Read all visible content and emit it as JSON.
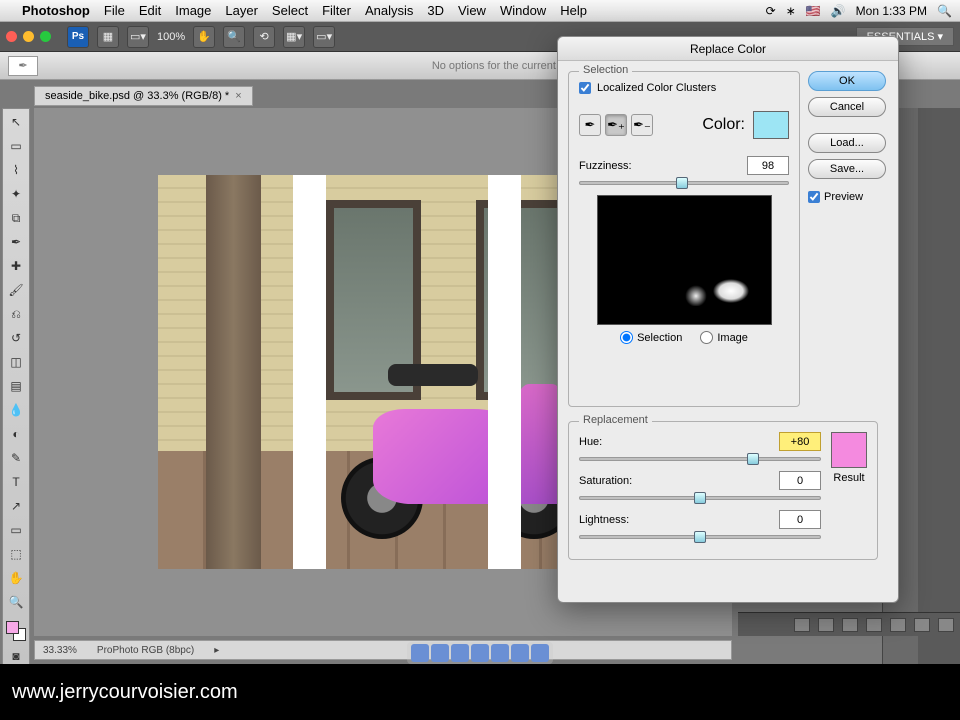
{
  "menubar": {
    "app": "Photoshop",
    "items": [
      "File",
      "Edit",
      "Image",
      "Layer",
      "Select",
      "Filter",
      "Analysis",
      "3D",
      "View",
      "Window",
      "Help"
    ],
    "clock": "Mon 1:33 PM"
  },
  "toolbar": {
    "zoom": "100%",
    "essentials": "ESSENTIALS ▾"
  },
  "optionsbar": {
    "msg": "No options for the current to"
  },
  "document": {
    "tab": "seaside_bike.psd @ 33.3% (RGB/8) *",
    "status_zoom": "33.33%",
    "status_profile": "ProPhoto RGB (8bpc)"
  },
  "dialog": {
    "title": "Replace Color",
    "selection_legend": "Selection",
    "localized_label": "Localized Color Clusters",
    "localized_checked": true,
    "color_label": "Color:",
    "sample_color": "#9de5f4",
    "fuzziness_label": "Fuzziness:",
    "fuzziness_value": "98",
    "radio_selection": "Selection",
    "radio_image": "Image",
    "replacement_legend": "Replacement",
    "hue_label": "Hue:",
    "hue_value": "+80",
    "saturation_label": "Saturation:",
    "saturation_value": "0",
    "lightness_label": "Lightness:",
    "lightness_value": "0",
    "result_label": "Result",
    "result_color": "#f48adf",
    "buttons": {
      "ok": "OK",
      "cancel": "Cancel",
      "load": "Load...",
      "save": "Save...",
      "preview": "Preview"
    },
    "preview_checked": true
  },
  "footer": {
    "url": "www.jerrycourvoisier.com"
  }
}
